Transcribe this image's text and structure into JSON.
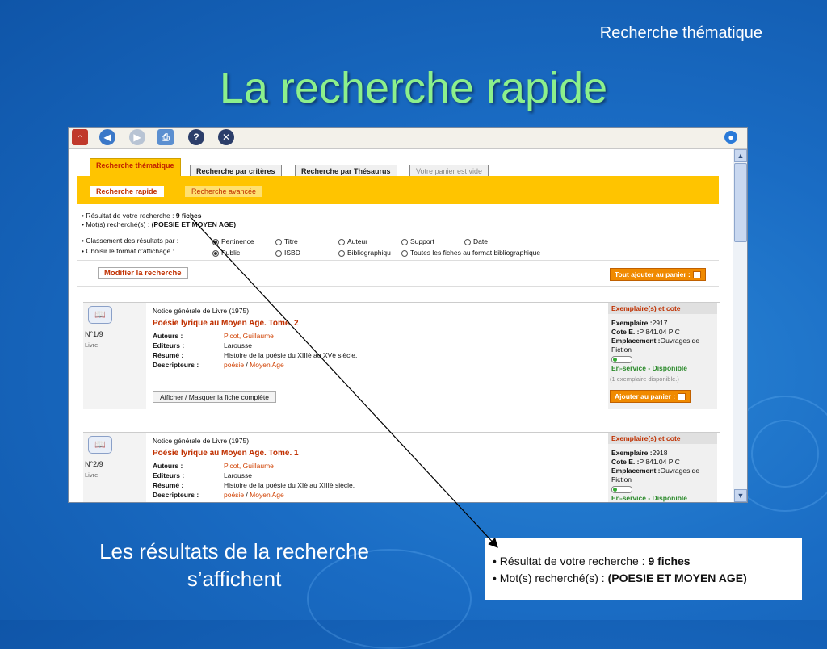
{
  "slide": {
    "subtitle": "Recherche thématique",
    "title": "La recherche rapide",
    "caption_line1": "Les résultats de la recherche",
    "caption_line2": "s’affichent"
  },
  "toolbar": {
    "icons": [
      "home-icon",
      "back-icon",
      "forward-icon",
      "print-icon",
      "help-icon",
      "close-icon",
      "globe-icon"
    ]
  },
  "tabs": [
    {
      "label": "Recherche thématique",
      "state": "active"
    },
    {
      "label": "Recherche par critères",
      "state": "normal"
    },
    {
      "label": "Recherche par Thésaurus",
      "state": "normal"
    },
    {
      "label": "Votre panier est vide",
      "state": "disabled"
    }
  ],
  "subtabs": {
    "rapide": "Recherche rapide",
    "avancee": "Recherche avancée"
  },
  "summary": {
    "result_label": "• Résultat de votre recherche : ",
    "result_count": "9 fiches",
    "words_label": "• Mot(s) recherché(s) : ",
    "words_value": "(POESIE ET MOYEN AGE)"
  },
  "sorting": {
    "label": "• Classement des résultats par :",
    "options": [
      "Pertinence",
      "Titre",
      "Auteur",
      "Support",
      "Date"
    ],
    "selected": "Pertinence"
  },
  "format": {
    "label": "• Choisir le format d'affichage :",
    "options": [
      "Public",
      "ISBD",
      "Bibliographiqu",
      "Toutes les fiches au format bibliographique"
    ],
    "selected": "Public"
  },
  "buttons": {
    "modify": "Modifier la recherche",
    "add_all": "Tout ajouter au panier :",
    "add": "Ajouter au panier :",
    "toggle_full": "Afficher / Masquer la fiche complète"
  },
  "labels": {
    "authors": "Auteurs :",
    "editors": "Editeurs :",
    "summary": "Résumé :",
    "descriptors": "Descripteurs :",
    "copies": "Exemplaire(s) et cote",
    "copy": "Exemplaire :",
    "shelf": "Cote E. :",
    "location": "Emplacement :"
  },
  "results": [
    {
      "number": "N°1/9",
      "kind": "Livre",
      "notice": "Notice générale de Livre  (1975)",
      "title": "Poésie lyrique au Moyen Age. Tome. 2",
      "author": "Picot, Guillaume",
      "editor": "Larousse",
      "summary": "Histoire de la poésie du XIIIè au XVè siècle.",
      "descriptor1": "poésie",
      "descriptor2": "Moyen Age",
      "copy": "2917",
      "shelf": "P 841.04 PIC",
      "location": "Ouvrages de Fiction",
      "status": "En-service - Disponible",
      "availability": "(1 exemplaire disponible.)"
    },
    {
      "number": "N°2/9",
      "kind": "Livre",
      "notice": "Notice générale de Livre  (1975)",
      "title": "Poésie lyrique au Moyen Age. Tome. 1",
      "author": "Picot, Guillaume",
      "editor": "Larousse",
      "summary": "Histoire de la poésie du XIè au XIIIè siècle.",
      "descriptor1": "poésie",
      "descriptor2": "Moyen Age",
      "copy": "2918",
      "shelf": "P 841.04 PIC",
      "location": "Ouvrages de Fiction",
      "status": "En-service - Disponible"
    }
  ],
  "zoom": {
    "line1_prefix": "• Résultat de votre recherche : ",
    "line1_bold": "9 fiches",
    "line2_prefix": "• Mot(s) recherché(s) : ",
    "line2_bold": "(POESIE ET MOYEN AGE)"
  }
}
